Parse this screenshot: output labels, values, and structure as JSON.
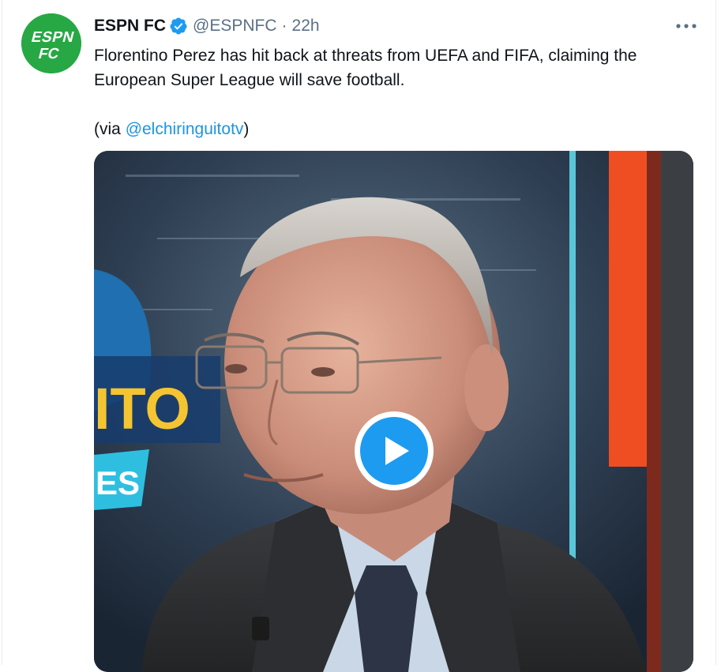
{
  "tweet": {
    "display_name": "ESPN FC",
    "handle": "@ESPNFC",
    "separator": "·",
    "time": "22h",
    "verified": true,
    "avatar": {
      "label": "ESPN FC",
      "color": "#27a844"
    },
    "text_line1": "Florentino Perez has hit back at threats from UEFA and FIFA, claiming the European Super League will save football.",
    "via_prefix": "(via ",
    "via_mention": "@elchiringuitotv",
    "via_suffix": ")",
    "media": {
      "type": "video",
      "overlay_text_top": "ITO",
      "overlay_text_bottom": "ES"
    }
  },
  "colors": {
    "accent": "#1d9bf0",
    "link": "#1b95e0",
    "muted": "#5b7083",
    "espn_green": "#27a844"
  },
  "icons": {
    "verified": "verified-badge-icon",
    "more": "more-options-icon",
    "play": "play-icon"
  }
}
